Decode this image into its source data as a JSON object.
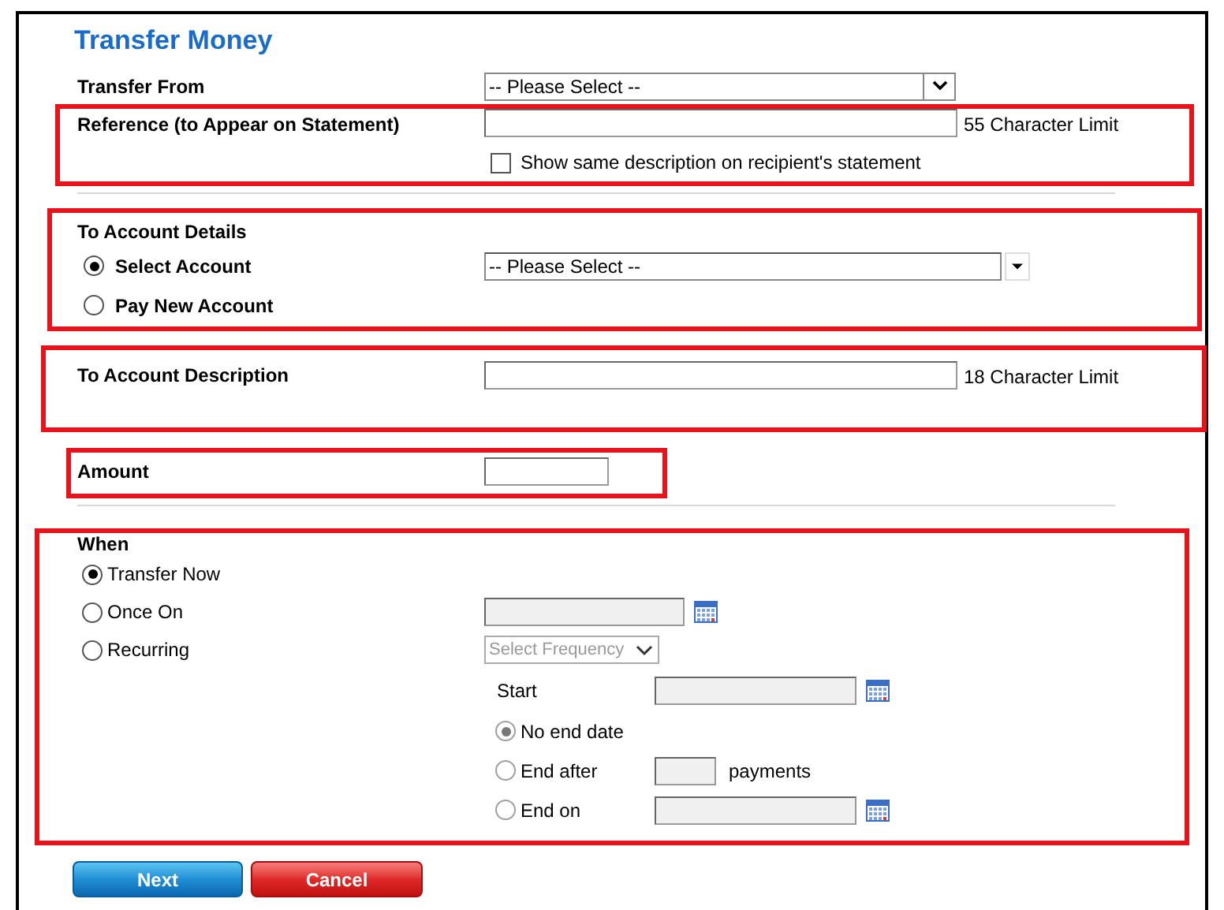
{
  "title": "Transfer Money",
  "sections": [
    {
      "kind": "transfer_from",
      "highlighted": false,
      "label": "Transfer From",
      "select": {
        "value": "-- Please Select --"
      }
    },
    {
      "kind": "reference",
      "highlighted": true,
      "label": "Reference (to Appear on Statement)",
      "note": "55 Character Limit",
      "checkbox": {
        "label": "Show same description on recipient's statement",
        "checked": false
      }
    },
    {
      "kind": "to_account",
      "highlighted": true,
      "label": "To Account Details",
      "options": [
        {
          "label": "Select Account",
          "selected": true
        },
        {
          "label": "Pay New Account",
          "selected": false
        }
      ],
      "select": {
        "value": "-- Please Select --"
      }
    },
    {
      "kind": "description",
      "highlighted": true,
      "label": "To Account Description",
      "note": "18 Character Limit"
    },
    {
      "kind": "amount",
      "highlighted": true,
      "label": "Amount"
    },
    {
      "kind": "when",
      "highlighted": true,
      "label": "When",
      "options": [
        {
          "label": "Transfer Now",
          "selected": true
        },
        {
          "label": "Once On",
          "selected": false
        },
        {
          "label": "Recurring",
          "selected": false
        }
      ],
      "frequency": {
        "placeholder": "Select Frequency"
      },
      "start_label": "Start",
      "end_options": [
        {
          "label": "No end date",
          "selected": true
        },
        {
          "label": "End after",
          "selected": false,
          "suffix": "payments"
        },
        {
          "label": "End on",
          "selected": false
        }
      ]
    }
  ],
  "buttons": [
    {
      "label": "Next",
      "kind": "primary"
    },
    {
      "label": "Cancel",
      "kind": "danger"
    }
  ]
}
